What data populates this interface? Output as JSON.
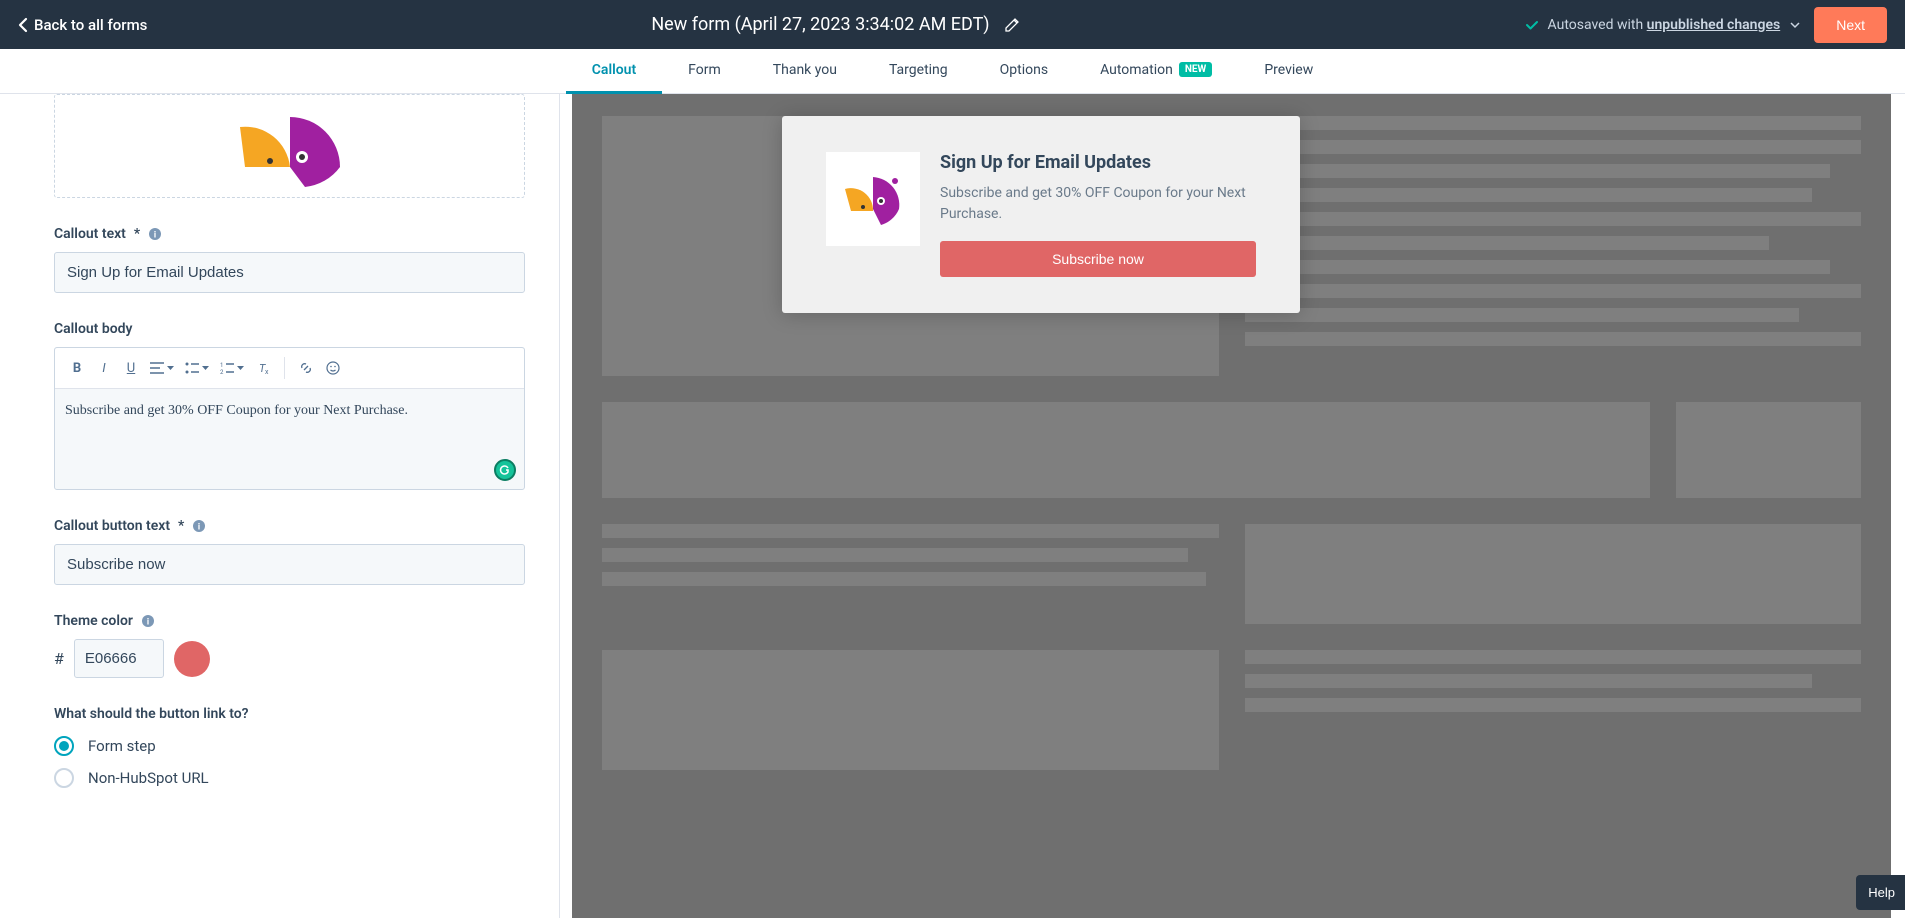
{
  "header": {
    "back_label": "Back to all forms",
    "form_title": "New form (April 27, 2023 3:34:02 AM EDT)",
    "autosave_prefix": "Autosaved with ",
    "autosave_link": "unpublished changes",
    "next_label": "Next"
  },
  "tabs": [
    {
      "label": "Callout",
      "active": true
    },
    {
      "label": "Form",
      "active": false
    },
    {
      "label": "Thank you",
      "active": false
    },
    {
      "label": "Targeting",
      "active": false
    },
    {
      "label": "Options",
      "active": false
    },
    {
      "label": "Automation",
      "active": false,
      "badge": "NEW"
    },
    {
      "label": "Preview",
      "active": false
    }
  ],
  "form": {
    "callout_text_label": "Callout text",
    "callout_text_value": "Sign Up for Email Updates",
    "callout_body_label": "Callout body",
    "callout_body_value": "Subscribe and get 30% OFF Coupon for your Next Purchase.",
    "button_text_label": "Callout button text",
    "button_text_value": "Subscribe now",
    "theme_color_label": "Theme color",
    "theme_color_hash": "#",
    "theme_color_value": "E06666",
    "theme_color_hex": "#E06666",
    "link_question": "What should the button link to?",
    "radio_options": [
      {
        "label": "Form step",
        "checked": true
      },
      {
        "label": "Non-HubSpot URL",
        "checked": false
      }
    ]
  },
  "preview": {
    "title": "Sign Up for Email Updates",
    "body": "Subscribe and get 30% OFF Coupon for your Next Purchase.",
    "button": "Subscribe now"
  },
  "help_label": "Help"
}
